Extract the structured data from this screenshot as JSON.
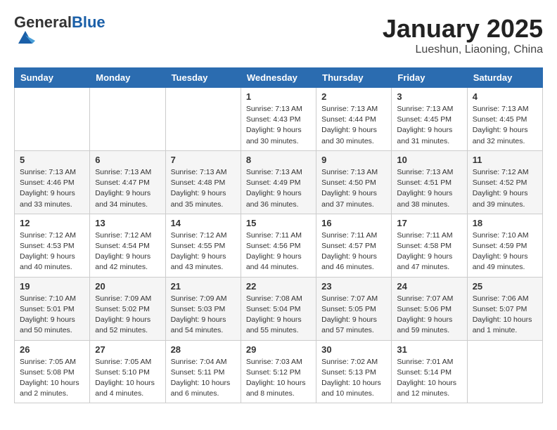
{
  "header": {
    "logo_general": "General",
    "logo_blue": "Blue",
    "month_title": "January 2025",
    "location": "Lueshun, Liaoning, China"
  },
  "weekdays": [
    "Sunday",
    "Monday",
    "Tuesday",
    "Wednesday",
    "Thursday",
    "Friday",
    "Saturday"
  ],
  "weeks": [
    [
      {
        "day": "",
        "info": ""
      },
      {
        "day": "",
        "info": ""
      },
      {
        "day": "",
        "info": ""
      },
      {
        "day": "1",
        "info": "Sunrise: 7:13 AM\nSunset: 4:43 PM\nDaylight: 9 hours\nand 30 minutes."
      },
      {
        "day": "2",
        "info": "Sunrise: 7:13 AM\nSunset: 4:44 PM\nDaylight: 9 hours\nand 30 minutes."
      },
      {
        "day": "3",
        "info": "Sunrise: 7:13 AM\nSunset: 4:45 PM\nDaylight: 9 hours\nand 31 minutes."
      },
      {
        "day": "4",
        "info": "Sunrise: 7:13 AM\nSunset: 4:45 PM\nDaylight: 9 hours\nand 32 minutes."
      }
    ],
    [
      {
        "day": "5",
        "info": "Sunrise: 7:13 AM\nSunset: 4:46 PM\nDaylight: 9 hours\nand 33 minutes."
      },
      {
        "day": "6",
        "info": "Sunrise: 7:13 AM\nSunset: 4:47 PM\nDaylight: 9 hours\nand 34 minutes."
      },
      {
        "day": "7",
        "info": "Sunrise: 7:13 AM\nSunset: 4:48 PM\nDaylight: 9 hours\nand 35 minutes."
      },
      {
        "day": "8",
        "info": "Sunrise: 7:13 AM\nSunset: 4:49 PM\nDaylight: 9 hours\nand 36 minutes."
      },
      {
        "day": "9",
        "info": "Sunrise: 7:13 AM\nSunset: 4:50 PM\nDaylight: 9 hours\nand 37 minutes."
      },
      {
        "day": "10",
        "info": "Sunrise: 7:13 AM\nSunset: 4:51 PM\nDaylight: 9 hours\nand 38 minutes."
      },
      {
        "day": "11",
        "info": "Sunrise: 7:12 AM\nSunset: 4:52 PM\nDaylight: 9 hours\nand 39 minutes."
      }
    ],
    [
      {
        "day": "12",
        "info": "Sunrise: 7:12 AM\nSunset: 4:53 PM\nDaylight: 9 hours\nand 40 minutes."
      },
      {
        "day": "13",
        "info": "Sunrise: 7:12 AM\nSunset: 4:54 PM\nDaylight: 9 hours\nand 42 minutes."
      },
      {
        "day": "14",
        "info": "Sunrise: 7:12 AM\nSunset: 4:55 PM\nDaylight: 9 hours\nand 43 minutes."
      },
      {
        "day": "15",
        "info": "Sunrise: 7:11 AM\nSunset: 4:56 PM\nDaylight: 9 hours\nand 44 minutes."
      },
      {
        "day": "16",
        "info": "Sunrise: 7:11 AM\nSunset: 4:57 PM\nDaylight: 9 hours\nand 46 minutes."
      },
      {
        "day": "17",
        "info": "Sunrise: 7:11 AM\nSunset: 4:58 PM\nDaylight: 9 hours\nand 47 minutes."
      },
      {
        "day": "18",
        "info": "Sunrise: 7:10 AM\nSunset: 4:59 PM\nDaylight: 9 hours\nand 49 minutes."
      }
    ],
    [
      {
        "day": "19",
        "info": "Sunrise: 7:10 AM\nSunset: 5:01 PM\nDaylight: 9 hours\nand 50 minutes."
      },
      {
        "day": "20",
        "info": "Sunrise: 7:09 AM\nSunset: 5:02 PM\nDaylight: 9 hours\nand 52 minutes."
      },
      {
        "day": "21",
        "info": "Sunrise: 7:09 AM\nSunset: 5:03 PM\nDaylight: 9 hours\nand 54 minutes."
      },
      {
        "day": "22",
        "info": "Sunrise: 7:08 AM\nSunset: 5:04 PM\nDaylight: 9 hours\nand 55 minutes."
      },
      {
        "day": "23",
        "info": "Sunrise: 7:07 AM\nSunset: 5:05 PM\nDaylight: 9 hours\nand 57 minutes."
      },
      {
        "day": "24",
        "info": "Sunrise: 7:07 AM\nSunset: 5:06 PM\nDaylight: 9 hours\nand 59 minutes."
      },
      {
        "day": "25",
        "info": "Sunrise: 7:06 AM\nSunset: 5:07 PM\nDaylight: 10 hours\nand 1 minute."
      }
    ],
    [
      {
        "day": "26",
        "info": "Sunrise: 7:05 AM\nSunset: 5:08 PM\nDaylight: 10 hours\nand 2 minutes."
      },
      {
        "day": "27",
        "info": "Sunrise: 7:05 AM\nSunset: 5:10 PM\nDaylight: 10 hours\nand 4 minutes."
      },
      {
        "day": "28",
        "info": "Sunrise: 7:04 AM\nSunset: 5:11 PM\nDaylight: 10 hours\nand 6 minutes."
      },
      {
        "day": "29",
        "info": "Sunrise: 7:03 AM\nSunset: 5:12 PM\nDaylight: 10 hours\nand 8 minutes."
      },
      {
        "day": "30",
        "info": "Sunrise: 7:02 AM\nSunset: 5:13 PM\nDaylight: 10 hours\nand 10 minutes."
      },
      {
        "day": "31",
        "info": "Sunrise: 7:01 AM\nSunset: 5:14 PM\nDaylight: 10 hours\nand 12 minutes."
      },
      {
        "day": "",
        "info": ""
      }
    ]
  ]
}
